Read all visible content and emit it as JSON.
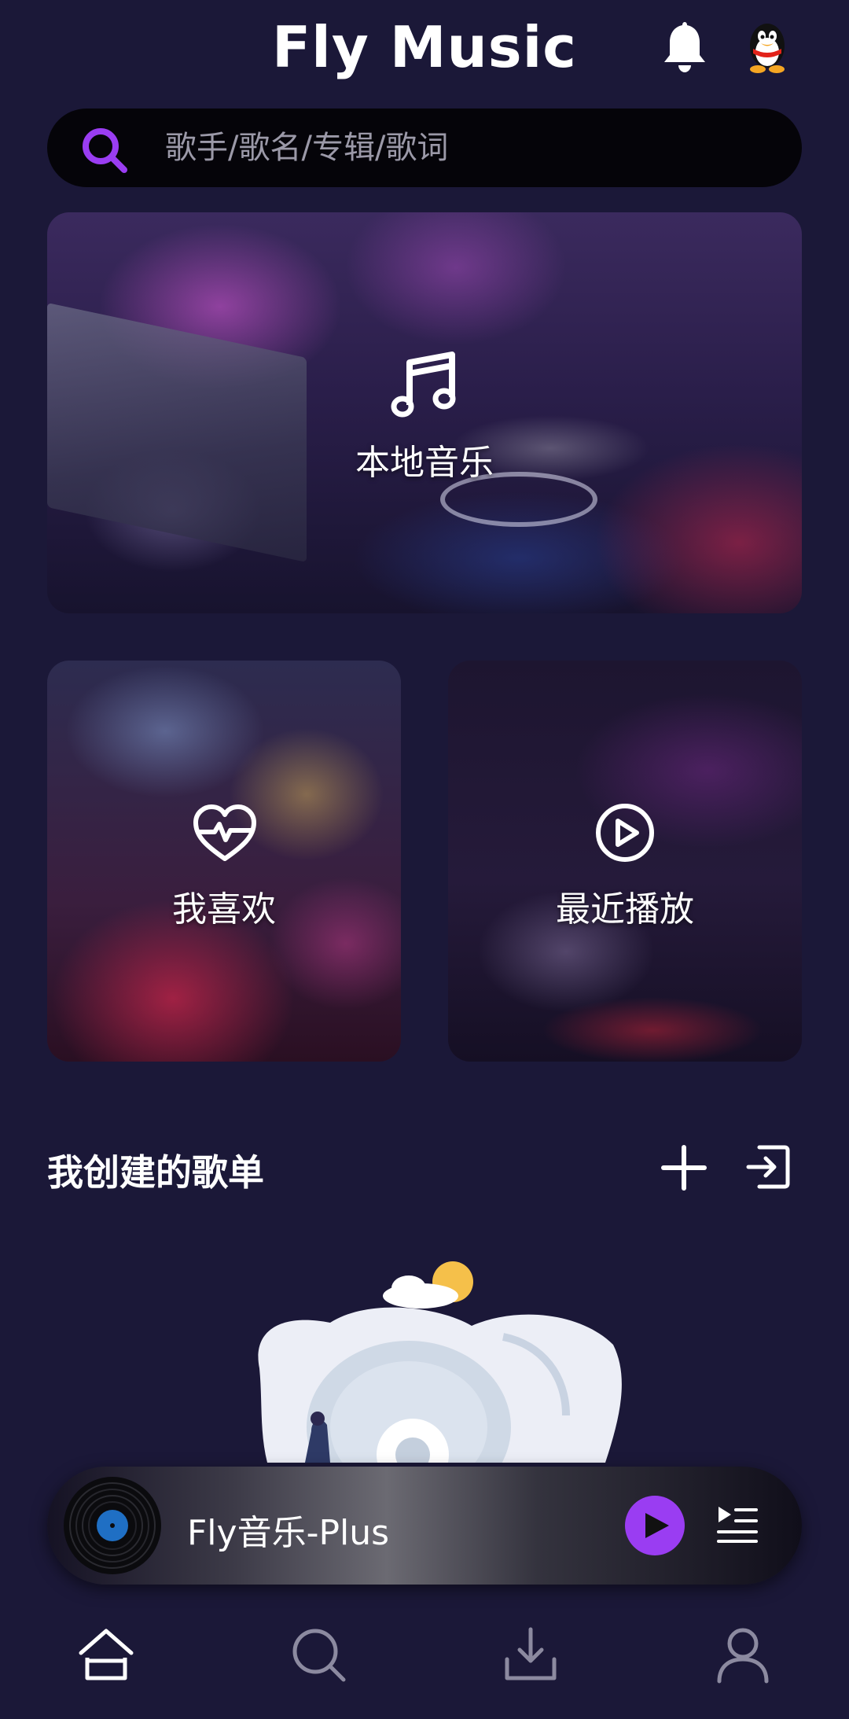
{
  "header": {
    "title": "Fly Music",
    "bell_icon": "bell-icon",
    "avatar_icon": "penguin-avatar"
  },
  "search": {
    "placeholder": "歌手/歌名/专辑/歌词",
    "value": "",
    "icon": "search-icon",
    "accent": "#9a3df2"
  },
  "cards": {
    "local": {
      "label": "本地音乐",
      "icon": "music-note-icon"
    },
    "favorite": {
      "label": "我喜欢",
      "icon": "heart-pulse-icon"
    },
    "recent": {
      "label": "最近播放",
      "icon": "play-circle-icon"
    }
  },
  "playlists": {
    "title": "我创建的歌单",
    "add_icon": "plus-icon",
    "import_icon": "import-icon"
  },
  "player": {
    "title": "Fly音乐-Plus",
    "state": "paused",
    "disc_icon": "vinyl-disc-icon",
    "play_icon": "play-icon",
    "queue_icon": "playlist-queue-icon",
    "accent": "#9a3df2"
  },
  "tabbar": {
    "items": [
      {
        "name": "home",
        "icon": "home-icon",
        "active": true
      },
      {
        "name": "search",
        "icon": "search-icon",
        "active": false
      },
      {
        "name": "download",
        "icon": "download-icon",
        "active": false
      },
      {
        "name": "profile",
        "icon": "user-icon",
        "active": false
      }
    ]
  },
  "colors": {
    "background": "#1b1838",
    "search_bg": "#050409",
    "active_tab": "#ffffff",
    "inactive_tab": "#8c8aa0"
  }
}
